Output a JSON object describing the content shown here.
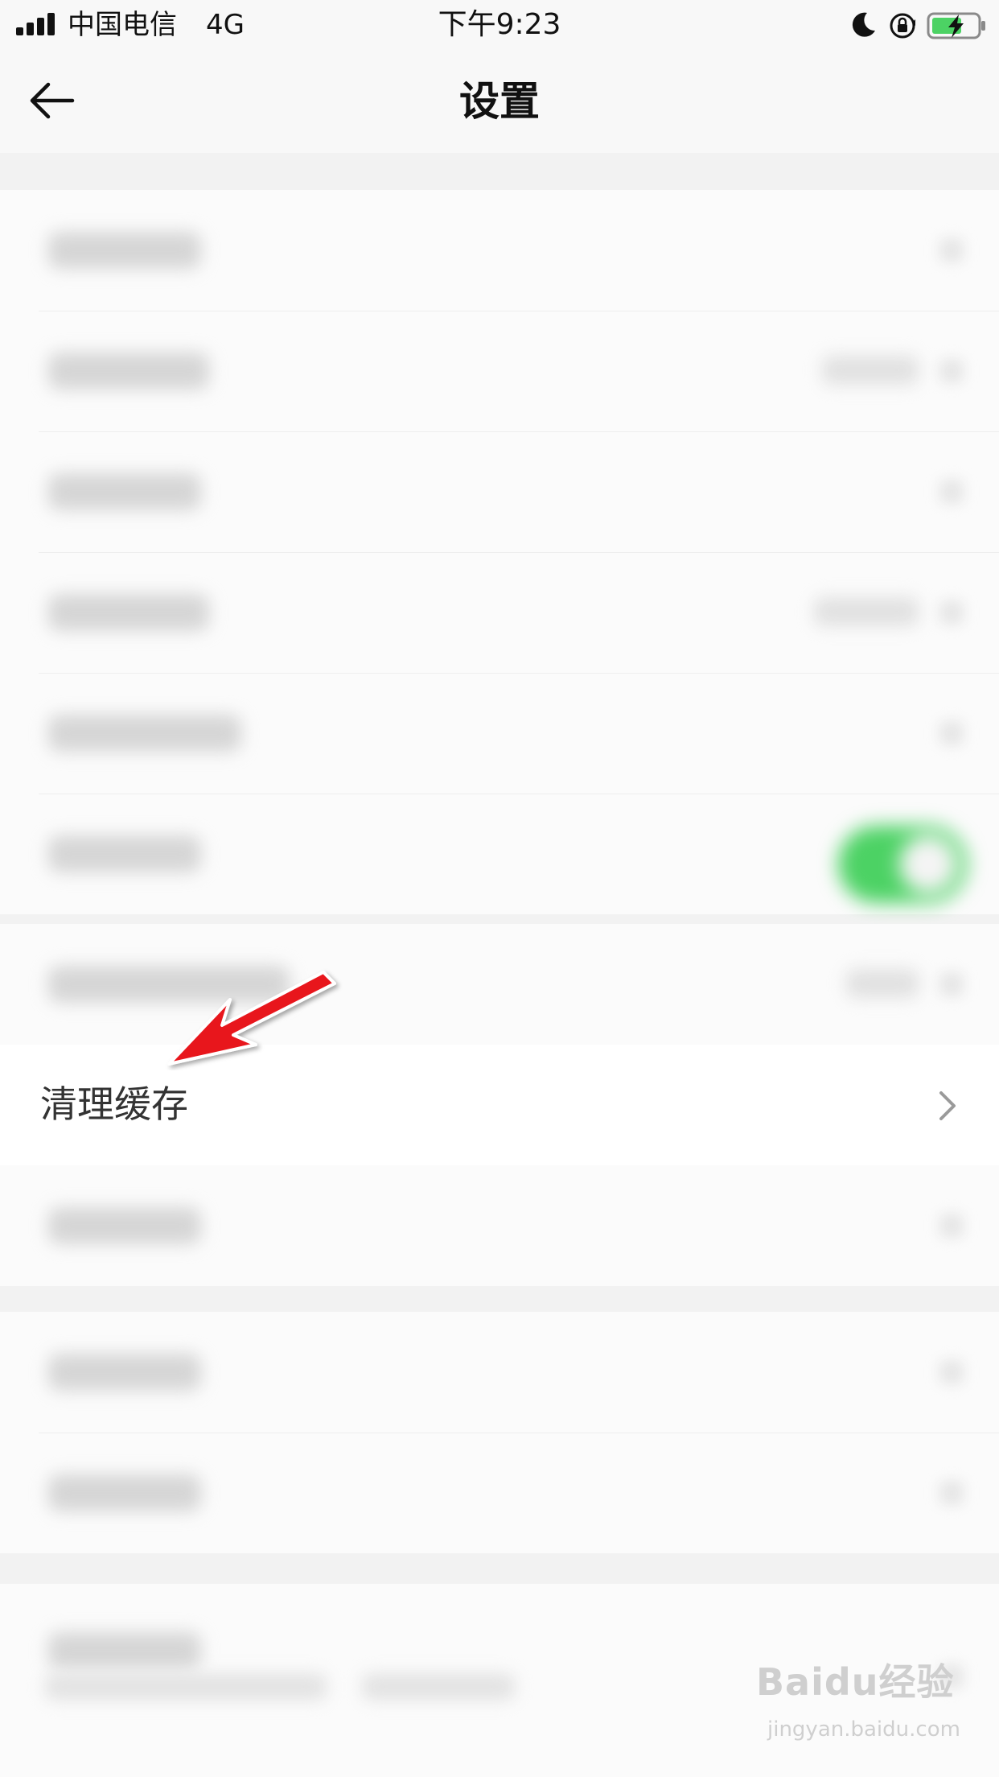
{
  "status_bar": {
    "carrier": "中国电信",
    "network": "4G",
    "time": "下午9:23",
    "icons": [
      "signal-icon",
      "moon-icon",
      "rotation-lock-icon",
      "battery-charging-icon"
    ]
  },
  "nav": {
    "title": "设置",
    "back_icon": "arrow-left-icon"
  },
  "focused_item": {
    "label": "清理缓存",
    "icon": "chevron-right-icon"
  },
  "annotation": {
    "icon": "red-arrow-icon",
    "color": "#e8141e"
  },
  "watermark": {
    "logo": "Baidu经验",
    "url": "jingyan.baidu.com"
  },
  "colors": {
    "toggle_on": "#4cd264",
    "battery_fill": "#4cd264",
    "background": "#f2f2f2"
  }
}
